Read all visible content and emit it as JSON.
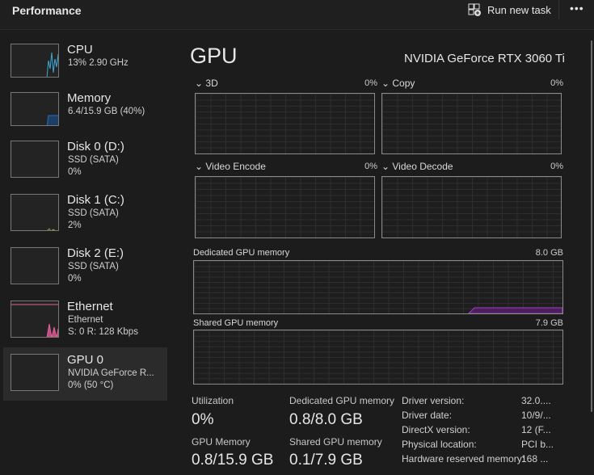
{
  "header": {
    "title": "Performance",
    "run_new_task": "Run new task",
    "more": "•••"
  },
  "sidebar": {
    "items": [
      {
        "name": "CPU",
        "line1": "13% 2.90 GHz",
        "line2": ""
      },
      {
        "name": "Memory",
        "line1": "6.4/15.9 GB (40%)",
        "line2": ""
      },
      {
        "name": "Disk 0 (D:)",
        "line1": "SSD (SATA)",
        "line2": "0%"
      },
      {
        "name": "Disk 1 (C:)",
        "line1": "SSD (SATA)",
        "line2": "2%"
      },
      {
        "name": "Disk 2 (E:)",
        "line1": "SSD (SATA)",
        "line2": "0%"
      },
      {
        "name": "Ethernet",
        "line1": "Ethernet",
        "line2": "S: 0 R: 128 Kbps"
      },
      {
        "name": "GPU 0",
        "line1": "NVIDIA GeForce R...",
        "line2": "0% (50 °C)"
      }
    ]
  },
  "main": {
    "title": "GPU",
    "model": "NVIDIA GeForce RTX 3060 Ti",
    "engines": [
      {
        "label": "3D",
        "pct": "0%"
      },
      {
        "label": "Copy",
        "pct": "0%"
      },
      {
        "label": "Video Encode",
        "pct": "0%"
      },
      {
        "label": "Video Decode",
        "pct": "0%"
      }
    ],
    "dedicated": {
      "label": "Dedicated GPU memory",
      "max": "8.0 GB"
    },
    "shared": {
      "label": "Shared GPU memory",
      "max": "7.9 GB"
    },
    "stats": {
      "util_label": "Utilization",
      "util": "0%",
      "ded_label": "Dedicated GPU memory",
      "ded": "0.8/8.0 GB",
      "gpumem_label": "GPU Memory",
      "gpumem": "0.8/15.9 GB",
      "shared_label": "Shared GPU memory",
      "shared": "0.1/7.9 GB"
    },
    "details": [
      {
        "k": "Driver version:",
        "v": "32.0...."
      },
      {
        "k": "Driver date:",
        "v": "10/9/..."
      },
      {
        "k": "DirectX version:",
        "v": "12 (F..."
      },
      {
        "k": "Physical location:",
        "v": "PCI b..."
      },
      {
        "k": "Hardware reserved memory:",
        "v": "168 ..."
      }
    ]
  },
  "colors": {
    "cpu": "#3fa9d6",
    "memory": "#2a6fb5",
    "disk": "#8a9a3a",
    "ethernet": "#e0609a",
    "gpu_mem": "#a040c0"
  }
}
